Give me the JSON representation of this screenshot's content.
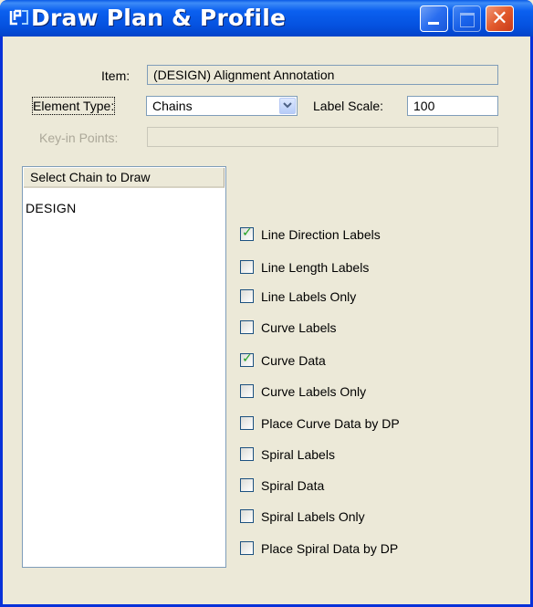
{
  "window": {
    "title": "Draw Plan & Profile",
    "close_glyph": "✕"
  },
  "form": {
    "item_label": "Item:",
    "item_value": "(DESIGN) Alignment Annotation",
    "element_type_label": "Element Type:",
    "element_type_value": "Chains",
    "label_scale_label": "Label Scale:",
    "label_scale_value": "100",
    "keyin_label": "Key-in Points:",
    "keyin_value": ""
  },
  "chain_list": {
    "header": "Select Chain to Draw",
    "items": [
      "DESIGN"
    ]
  },
  "options": [
    {
      "label": "Line Direction Labels",
      "checked": true
    },
    {
      "label": "Line Length Labels",
      "checked": false
    },
    {
      "label": "Line Labels Only",
      "checked": false
    },
    {
      "label": "Curve Labels",
      "checked": false
    },
    {
      "label": "Curve Data",
      "checked": true
    },
    {
      "label": "Curve Labels Only",
      "checked": false
    },
    {
      "label": "Place Curve Data by DP",
      "checked": false
    },
    {
      "label": "Spiral Labels",
      "checked": false
    },
    {
      "label": "Spiral Data",
      "checked": false
    },
    {
      "label": "Spiral Labels Only",
      "checked": false
    },
    {
      "label": "Place Spiral Data by DP",
      "checked": false
    }
  ],
  "colors": {
    "titlebar": "#0b60f0",
    "window_bg": "#ece9d8",
    "close_button": "#e25a2c",
    "check_mark": "#21a121"
  },
  "icons": {
    "app": "app-icon",
    "minimize": "minimize-icon",
    "maximize": "maximize-icon",
    "close": "close-icon",
    "dropdown": "chevron-down-icon"
  }
}
